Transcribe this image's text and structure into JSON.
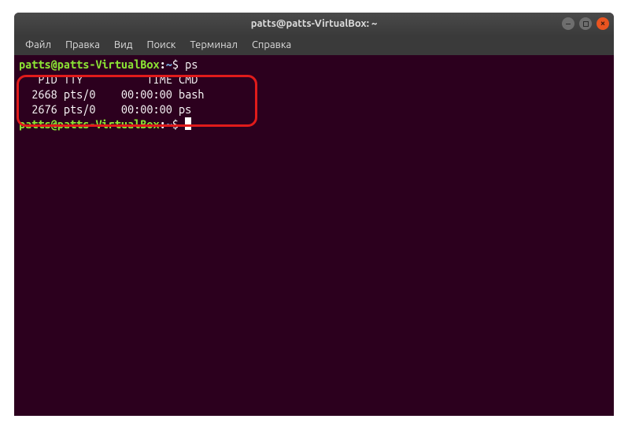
{
  "window": {
    "title": "patts@patts-VirtualBox: ~"
  },
  "menubar": {
    "items": [
      {
        "label": "Файл"
      },
      {
        "label": "Правка"
      },
      {
        "label": "Вид"
      },
      {
        "label": "Поиск"
      },
      {
        "label": "Терминал"
      },
      {
        "label": "Справка"
      }
    ]
  },
  "terminal": {
    "prompt": {
      "user_host": "patts@patts-VirtualBox",
      "colon": ":",
      "path": "~",
      "symbol": "$"
    },
    "lines": [
      {
        "type": "prompt",
        "command": "ps"
      },
      {
        "type": "output",
        "text": "   PID TTY          TIME CMD"
      },
      {
        "type": "output",
        "text": "  2668 pts/0    00:00:00 bash"
      },
      {
        "type": "output",
        "text": "  2676 pts/0    00:00:00 ps"
      },
      {
        "type": "prompt",
        "command": "",
        "cursor": true
      }
    ]
  },
  "ps_table": {
    "headers": [
      "PID",
      "TTY",
      "TIME",
      "CMD"
    ],
    "rows": [
      {
        "PID": "2668",
        "TTY": "pts/0",
        "TIME": "00:00:00",
        "CMD": "bash"
      },
      {
        "PID": "2676",
        "TTY": "pts/0",
        "TIME": "00:00:00",
        "CMD": "ps"
      }
    ]
  },
  "colors": {
    "terminal_bg": "#2c001e",
    "prompt_user": "#8ae234",
    "prompt_path": "#729fcf",
    "highlight_border": "#e01b1b",
    "close_btn": "#e95420"
  }
}
